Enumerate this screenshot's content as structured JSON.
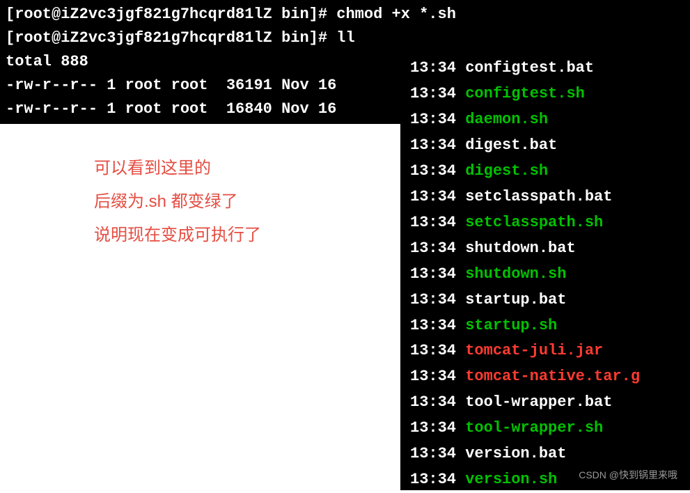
{
  "prompt": {
    "user_host": "[root@iZ2vc3jgf821g7hcqrd81lZ bin]#",
    "cmd1": "chmod +x *.sh",
    "cmd2": "ll"
  },
  "total_line": "total 888",
  "ls_rows": [
    "-rw-r--r-- 1 root root  36191 Nov 16",
    "-rw-r--r-- 1 root root  16840 Nov 16"
  ],
  "files": [
    {
      "time": "13:34",
      "name": "configtest.bat",
      "color": "white"
    },
    {
      "time": "13:34",
      "name": "configtest.sh",
      "color": "green"
    },
    {
      "time": "13:34",
      "name": "daemon.sh",
      "color": "green"
    },
    {
      "time": "13:34",
      "name": "digest.bat",
      "color": "white"
    },
    {
      "time": "13:34",
      "name": "digest.sh",
      "color": "green"
    },
    {
      "time": "13:34",
      "name": "setclasspath.bat",
      "color": "white"
    },
    {
      "time": "13:34",
      "name": "setclasspath.sh",
      "color": "green"
    },
    {
      "time": "13:34",
      "name": "shutdown.bat",
      "color": "white"
    },
    {
      "time": "13:34",
      "name": "shutdown.sh",
      "color": "green"
    },
    {
      "time": "13:34",
      "name": "startup.bat",
      "color": "white"
    },
    {
      "time": "13:34",
      "name": "startup.sh",
      "color": "green"
    },
    {
      "time": "13:34",
      "name": "tomcat-juli.jar",
      "color": "red"
    },
    {
      "time": "13:34",
      "name": "tomcat-native.tar.g",
      "color": "red"
    },
    {
      "time": "13:34",
      "name": "tool-wrapper.bat",
      "color": "white"
    },
    {
      "time": "13:34",
      "name": "tool-wrapper.sh",
      "color": "green"
    },
    {
      "time": "13:34",
      "name": "version.bat",
      "color": "white"
    },
    {
      "time": "13:34",
      "name": "version.sh",
      "color": "green"
    }
  ],
  "annotation": {
    "line1": "可以看到这里的",
    "line2": "后缀为.sh 都变绿了",
    "line3": "说明现在变成可执行了"
  },
  "watermark": "CSDN @快到锅里来哦"
}
